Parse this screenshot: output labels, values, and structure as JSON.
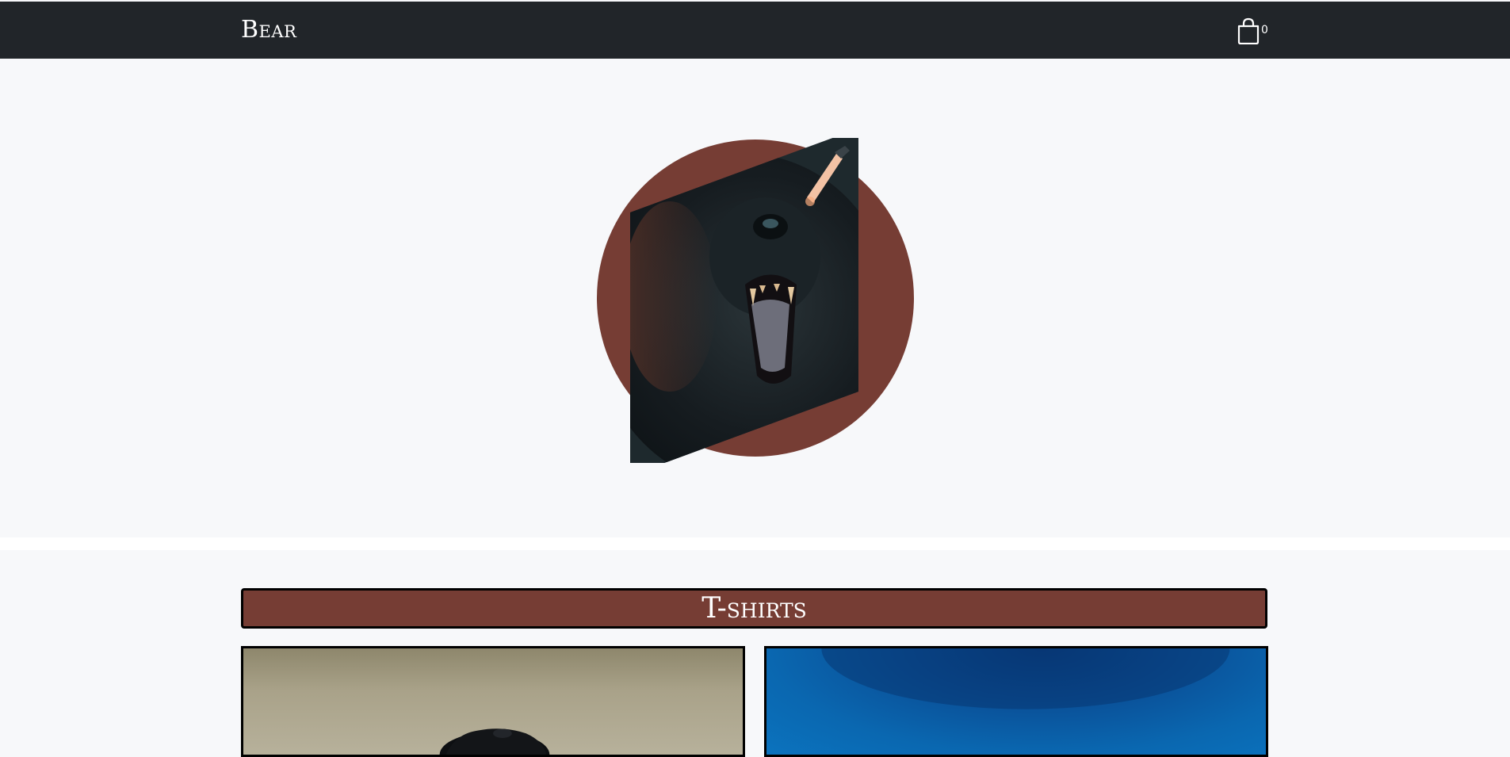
{
  "header": {
    "brand": "Bear",
    "cart_count": "0"
  },
  "hero": {
    "image": "roaring-bear-photo"
  },
  "products": {
    "section_title": "T-shirts",
    "cards": [
      {
        "image": "man-portrait-photo"
      },
      {
        "image": "blue-sky-photo"
      }
    ]
  },
  "colors": {
    "navbar": "#212529",
    "accent": "#763d34",
    "background": "#f7f8fa"
  }
}
